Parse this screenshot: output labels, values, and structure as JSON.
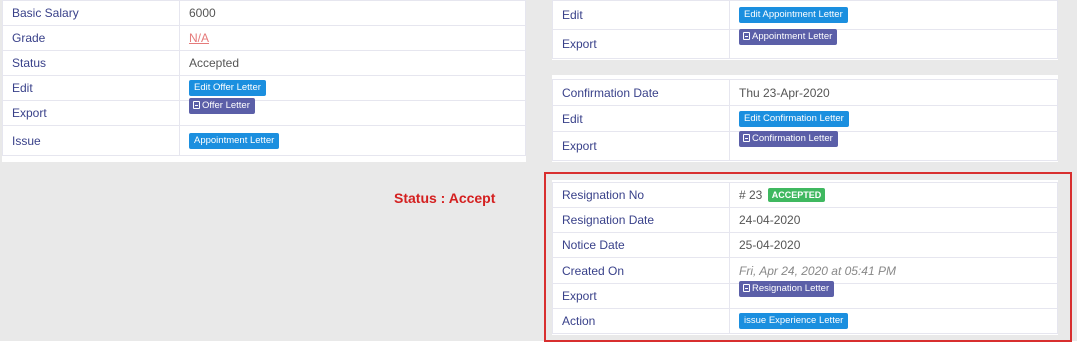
{
  "left_card": {
    "basic_salary_label": "Basic Salary",
    "basic_salary_value": "6000",
    "grade_label": "Grade",
    "grade_value": "N/A",
    "status_label": "Status",
    "status_value": "Accepted",
    "edit_label": "Edit",
    "edit_button": "Edit Offer Letter",
    "export_label": "Export",
    "export_button": "Offer Letter",
    "issue_label": "Issue",
    "issue_button": "Appointment Letter"
  },
  "top_right_card": {
    "edit_label": "Edit",
    "edit_button": "Edit Appointment Letter",
    "export_label": "Export",
    "export_button": "Appointment Letter"
  },
  "confirmation_card": {
    "date_label": "Confirmation Date",
    "date_value": "Thu 23-Apr-2020",
    "edit_label": "Edit",
    "edit_button": "Edit Confirmation Letter",
    "export_label": "Export",
    "export_button": "Confirmation Letter"
  },
  "annotation": {
    "status_note": "Status : Accept"
  },
  "resignation_card": {
    "no_label": "Resignation No",
    "no_value": "# 23",
    "status_badge": "ACCEPTED",
    "date_label": "Resignation Date",
    "date_value": "24-04-2020",
    "notice_label": "Notice Date",
    "notice_value": "25-04-2020",
    "created_label": "Created On",
    "created_value": "Fri, Apr 24, 2020 at 05:41 PM",
    "export_label": "Export",
    "export_button": "Resignation Letter",
    "action_label": "Action",
    "action_button": "issue Experience Letter"
  },
  "colors": {
    "label_text": "#39418a",
    "primary_button": "#1b8fdf",
    "export_button": "#5b5fa8",
    "accepted_badge": "#3fb860",
    "highlight_border": "#d82f2f",
    "link_na": "#e57a7a"
  },
  "icons": {
    "export_button_icon": "pdf-file-icon"
  }
}
